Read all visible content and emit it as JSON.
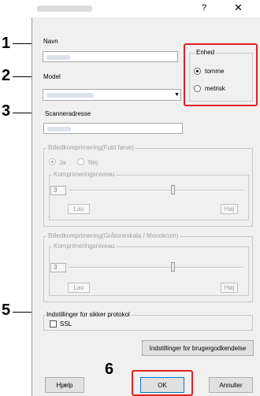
{
  "window": {
    "help_glyph": "?",
    "close_glyph": "✕"
  },
  "markers": [
    "1",
    "2",
    "3",
    "5",
    "6"
  ],
  "fields": {
    "name_label": "Navn",
    "model_label": "Model",
    "scanner_label": "Scanneradresse"
  },
  "unit_group": {
    "title": "Enhed",
    "option_inch": "tomme",
    "option_metric": "metrisk",
    "selected": "tomme"
  },
  "compression_color": {
    "title": "Billedkomprimering(Fuld farve)",
    "yes": "Ja",
    "no": "Nej",
    "level_title": "Komprimeringsniveau",
    "level_value": "3",
    "low": "Lav",
    "high": "Høj",
    "slider_fraction": 0.6
  },
  "compression_gray": {
    "title": "Billedkomprimering(Gråtoneskala / Monokrom)",
    "level_title": "Komprimeringsniveau",
    "level_value": "3",
    "low": "Lav",
    "high": "Høj",
    "slider_fraction": 0.6
  },
  "secure": {
    "title": "Indstillinger for sikker protokol",
    "ssl_label": "SSL",
    "ssl_checked": false
  },
  "buttons": {
    "auth_settings": "Indstillinger for brugergodkendelse",
    "help": "Hjælp",
    "ok": "OK",
    "cancel": "Annuller"
  },
  "colors": {
    "highlight": "#e02020",
    "dialog_bg": "#f0f0f0"
  }
}
